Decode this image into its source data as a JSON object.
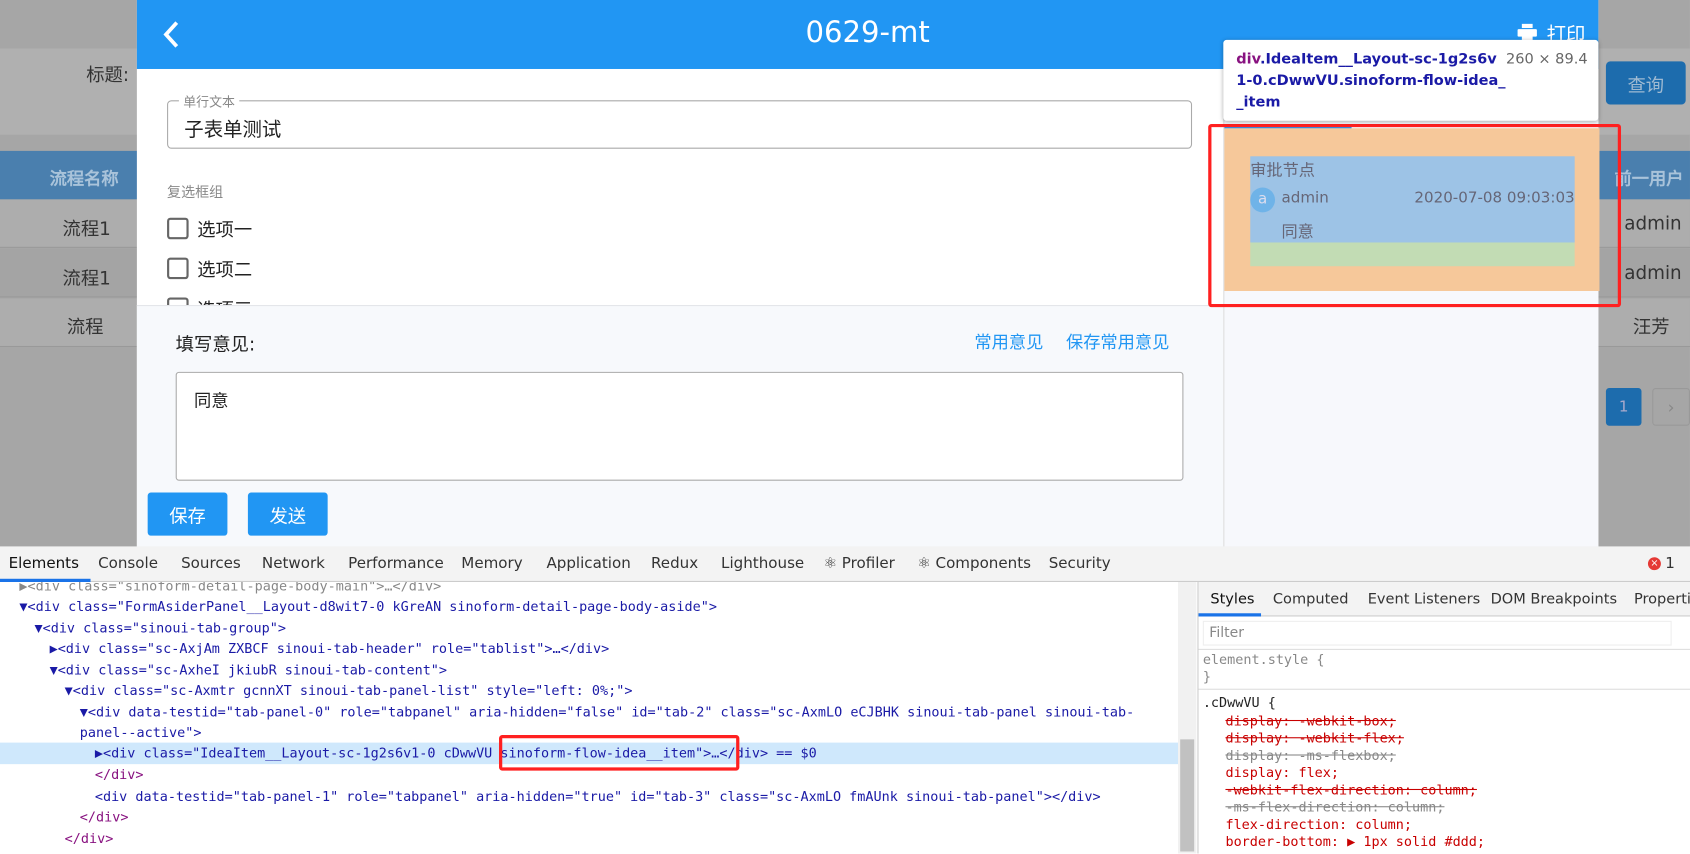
{
  "background": {
    "title_label": "标题:",
    "query_button": "查询",
    "table": {
      "left_header": "流程名称",
      "right_header": "前一用户",
      "rows": [
        {
          "name": "流程1",
          "user": "admin"
        },
        {
          "name": "流程1",
          "user": "admin"
        },
        {
          "name": "流程",
          "user": "汪芳"
        }
      ]
    },
    "pagination": {
      "current": "1",
      "next": "›"
    }
  },
  "modal": {
    "title": "0629-mt",
    "print_label": "打印",
    "text_field": {
      "label": "单行文本",
      "value": "子表单测试"
    },
    "checkbox_group": {
      "label": "复选框组",
      "options": [
        "选项一",
        "选项二",
        "选项三"
      ]
    },
    "opinion": {
      "label": "填写意见:",
      "common_link": "常用意见",
      "save_common_link": "保存常用意见",
      "value": "同意"
    },
    "save_button": "保存",
    "send_button": "发送",
    "idea_item": {
      "node": "审批节点",
      "avatar": "a",
      "user": "admin",
      "time": "2020-07-08 09:03:03",
      "comment": "同意"
    }
  },
  "inspector_tooltip": {
    "tag": "div",
    "selector": ".IdeaItem__Layout-sc-1g2s6v1-0.cDwwVU.sinoform-flow-idea__item",
    "size": "260 × 89.4"
  },
  "devtools": {
    "tabs": [
      "Elements",
      "Console",
      "Sources",
      "Network",
      "Performance",
      "Memory",
      "Application",
      "Redux",
      "Lighthouse",
      "⚛ Profiler",
      "⚛ Components",
      "Security"
    ],
    "active_tab": "Elements",
    "error_count": "1",
    "dom_lines": [
      "▶<div class=\"sinoform-detail-page-body-main\">…</div>",
      "▼<div class=\"FormAsiderPanel__Layout-d8wit7-0 kGreAN sinoform-detail-page-body-aside\">",
      "▼<div class=\"sinoui-tab-group\">",
      "▶<div class=\"sc-AxjAm ZXBCF sinoui-tab-header\" role=\"tablist\">…</div>",
      "▼<div class=\"sc-AxheI jkiubR sinoui-tab-content\">",
      "▼<div class=\"sc-Axmtr gcnnXT sinoui-tab-panel-list\" style=\"left: 0%;\">",
      "▼<div data-testid=\"tab-panel-0\" role=\"tabpanel\" aria-hidden=\"false\" id=\"tab-2\" class=\"sc-AxmLO eCJBHK sinoui-tab-panel sinoui-tab-",
      "panel--active\">",
      "▶<div class=\"IdeaItem__Layout-sc-1g2s6v1-0 cDwwVU sinoform-flow-idea__item\">…</div> == $0",
      "</div>",
      "<div data-testid=\"tab-panel-1\" role=\"tabpanel\" aria-hidden=\"true\" id=\"tab-3\" class=\"sc-AxmLO fmAUnk sinoui-tab-panel\"></div>",
      "</div>",
      "</div>"
    ],
    "sidebar_tabs": [
      "Styles",
      "Computed",
      "Event Listeners",
      "DOM Breakpoints",
      "Properties"
    ],
    "filter_placeholder": "Filter",
    "styles": [
      "element.style {",
      "}",
      ".cDwwVU {",
      "display: -webkit-box;",
      "display: -webkit-flex;",
      "display: -ms-flexbox;",
      "display: flex;",
      "-webkit-flex-direction: column;",
      "-ms-flex-direction: column;",
      "flex-direction: column;",
      "border-bottom: ▶ 1px solid #ddd;"
    ]
  },
  "colors": {
    "primary": "#2196f3",
    "highlight_margin": "#f6c89a",
    "highlight_content": "#9dc3e6",
    "highlight_padding": "#c2dcb4",
    "annotation": "#ff2020"
  }
}
